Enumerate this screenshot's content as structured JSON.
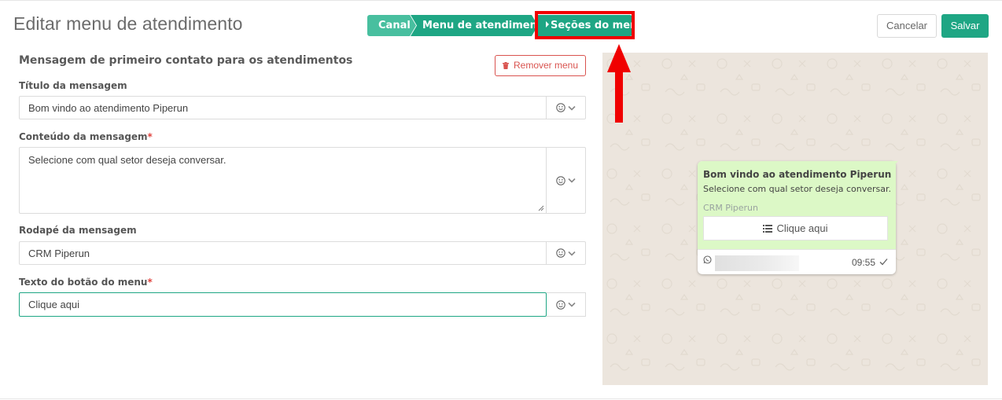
{
  "page": {
    "title": "Editar menu de atendimento"
  },
  "stepper": {
    "steps": [
      "Canal",
      "Menu de atendimento",
      "Seções do menu"
    ]
  },
  "actions": {
    "cancel_label": "Cancelar",
    "save_label": "Salvar"
  },
  "section": {
    "title": "Mensagem de primeiro contato para os atendimentos",
    "remove_label": "Remover menu"
  },
  "form": {
    "title_label": "Título da mensagem",
    "title_value": "Bom vindo ao atendimento Piperun",
    "content_label": "Conteúdo da mensagem",
    "content_value": "Selecione com qual setor deseja conversar.",
    "footer_label": "Rodapé da mensagem",
    "footer_value": "CRM Piperun",
    "button_label": "Texto do botão do menu",
    "button_value": "Clique aqui",
    "required_mark": "*"
  },
  "preview": {
    "title": "Bom vindo ao atendimento Piperun",
    "content": "Selecione com qual setor deseja conversar.",
    "footer": "CRM Piperun",
    "button": "Clique aqui",
    "time": "09:55"
  },
  "colors": {
    "brand": "#1ea684",
    "brand_light": "#48bf9f",
    "danger": "#d9534f",
    "annotation": "#f00000",
    "bubble": "#dcf8c6",
    "preview_bg": "#ece5dd"
  },
  "icons": {
    "emoji": "smiley-icon",
    "dropdown": "chevron-down-icon",
    "remove": "trash-icon",
    "menu_button": "list-icon",
    "whatsapp": "whatsapp-icon",
    "check": "check-icon"
  }
}
